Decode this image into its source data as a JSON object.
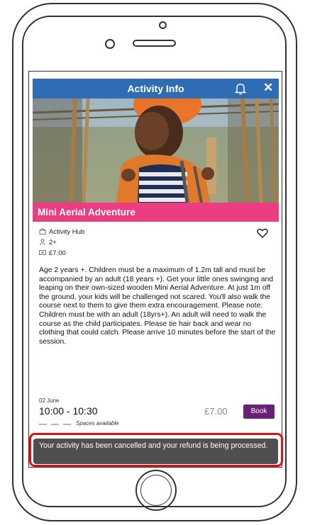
{
  "app_header": {
    "title": "Activity Info",
    "bell_icon": "bell-icon",
    "close_label": "✕"
  },
  "activity": {
    "name": "Mini Aerial Adventure",
    "venue": "Activity Hub",
    "age": "2+",
    "price": "£7.00",
    "description": "Age 2 years +. Children must be a maximum of 1.2m tall and must be accompanied by an adult (18 years +). Get your little ones swinging and leaping on their own-sized wooden Mini Aerial Adventure. At just 1m off the ground, your kids will be challenged not scared. You'll also walk the course next to them to give them extra encouragement. Please note: Children must be with an adult (18yrs+). An adult will need to walk the course as the child participates. Please tie hair back and wear no clothing that could catch. Please arrive 10 minutes before the start of the session."
  },
  "session": {
    "date": "02 June",
    "time": "10:00 - 10:30",
    "price": "£7.00",
    "book_label": "Book",
    "availability": "Spaces available"
  },
  "toast": {
    "message": "Your activity has been cancelled and your refund is being processed."
  },
  "colors": {
    "header": "#2e6db4",
    "title_bar": "#ea3d82",
    "book_button": "#6b2078",
    "toast": "#4f4f4f",
    "highlight": "#e01010"
  }
}
